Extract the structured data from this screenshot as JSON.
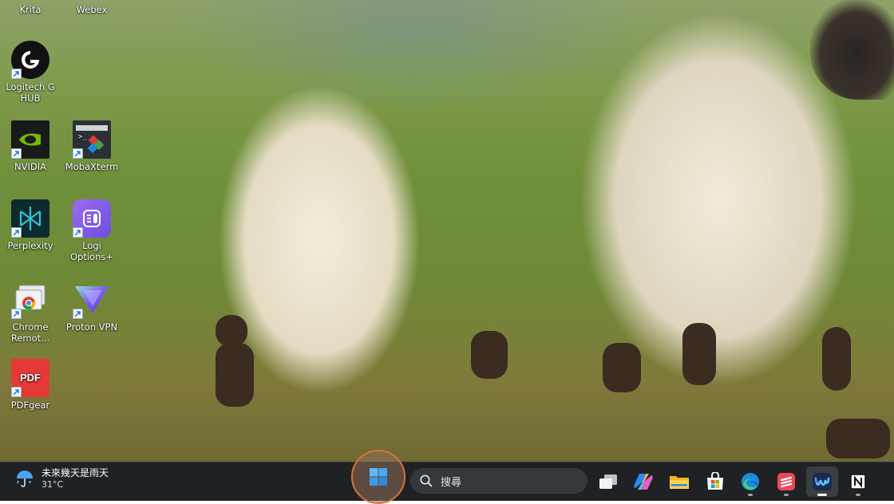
{
  "desktop_icons": [
    {
      "id": "krita",
      "label": "Krita"
    },
    {
      "id": "webex",
      "label": "Webex"
    },
    {
      "id": "logitech",
      "label": "Logitech G HUB"
    },
    {
      "id": "nvidia",
      "label": "NVIDIA"
    },
    {
      "id": "mobaxterm",
      "label": "MobaXterm"
    },
    {
      "id": "perplexity",
      "label": "Perplexity"
    },
    {
      "id": "logi",
      "label": "Logi Options+"
    },
    {
      "id": "chrome-remote",
      "label": "Chrome Remot..."
    },
    {
      "id": "proton",
      "label": "Proton VPN"
    },
    {
      "id": "pdfgear",
      "label": "PDFgear"
    }
  ],
  "pdf_icon_text": "PDF",
  "taskbar": {
    "weather": {
      "text": "未來幾天是雨天",
      "temp": "31°C"
    },
    "search": {
      "placeholder": "搜尋"
    },
    "apps": [
      {
        "name": "task-view",
        "icon": "task-view-icon"
      },
      {
        "name": "copilot",
        "icon": "copilot-icon"
      },
      {
        "name": "file-explorer",
        "icon": "folder-icon"
      },
      {
        "name": "microsoft-store",
        "icon": "store-icon"
      },
      {
        "name": "edge",
        "icon": "edge-icon"
      },
      {
        "name": "app-red",
        "icon": "red-app-icon"
      },
      {
        "name": "webex",
        "icon": "webex-icon",
        "active": true
      },
      {
        "name": "notion",
        "icon": "notion-icon"
      }
    ]
  },
  "colors": {
    "taskbar_bg": "#1f2224",
    "start_highlight": "#d8743a",
    "search_bg": "#34383c"
  }
}
